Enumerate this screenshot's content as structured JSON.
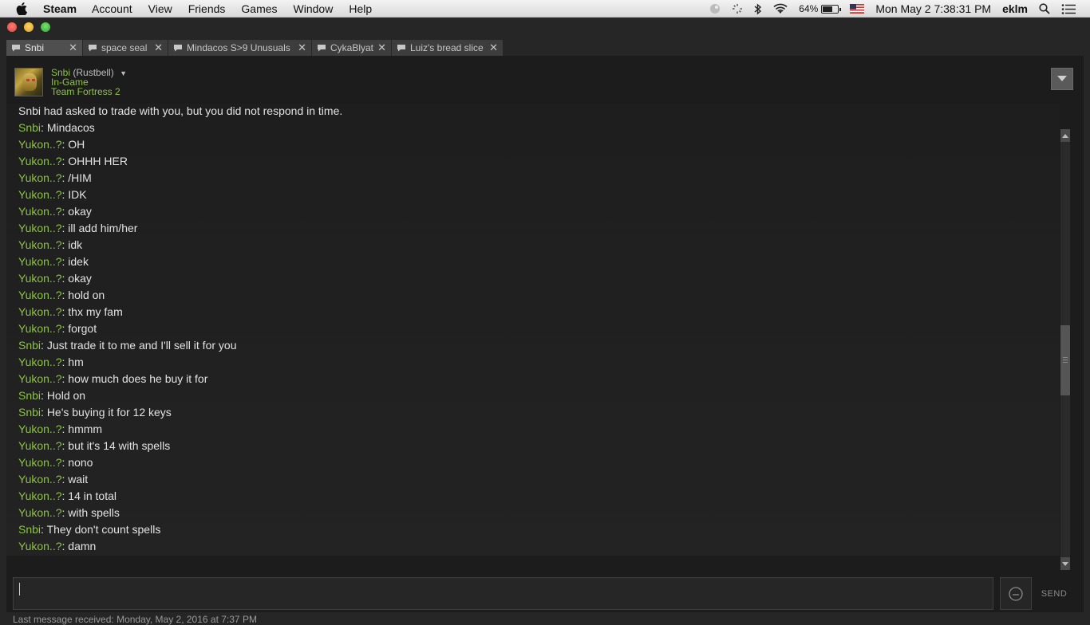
{
  "menubar": {
    "app": "Steam",
    "items": [
      "Account",
      "View",
      "Friends",
      "Games",
      "Window",
      "Help"
    ],
    "battery": "64%",
    "datetime": "Mon May 2  7:38:31 PM",
    "user": "eklm"
  },
  "tabs": [
    {
      "label": "Snbi",
      "active": true
    },
    {
      "label": "space seal",
      "active": false
    },
    {
      "label": "Mindacos S>9 Unusuals",
      "active": false
    },
    {
      "label": "CykaBlyat",
      "active": false
    },
    {
      "label": "Luiz's bread slice",
      "active": false
    }
  ],
  "friend": {
    "name": "Snbi",
    "realname": "(Rustbell)",
    "status": "In-Game",
    "game": "Team Fortress 2"
  },
  "messages": [
    {
      "who": "",
      "text": "Snbi had asked to trade with you, but you did not respond in time.",
      "system": true
    },
    {
      "who": "Snbi",
      "text": "Mindacos"
    },
    {
      "who": "Yukon..?",
      "text": "OH"
    },
    {
      "who": "Yukon..?",
      "text": "OHHH HER"
    },
    {
      "who": "Yukon..?",
      "text": "/HIM"
    },
    {
      "who": "Yukon..?",
      "text": "IDK"
    },
    {
      "who": "Yukon..?",
      "text": "okay"
    },
    {
      "who": "Yukon..?",
      "text": "ill add him/her"
    },
    {
      "who": "Yukon..?",
      "text": "idk"
    },
    {
      "who": "Yukon..?",
      "text": "idek"
    },
    {
      "who": "Yukon..?",
      "text": "okay"
    },
    {
      "who": "Yukon..?",
      "text": "hold on"
    },
    {
      "who": "Yukon..?",
      "text": "thx my fam"
    },
    {
      "who": "Yukon..?",
      "text": "forgot"
    },
    {
      "who": "Snbi",
      "text": "Just trade it to me and I'll sell it for you"
    },
    {
      "who": "Yukon..?",
      "text": "hm"
    },
    {
      "who": "Yukon..?",
      "text": "how much does he buy it for"
    },
    {
      "who": "Snbi",
      "text": "Hold on"
    },
    {
      "who": "Snbi",
      "text": "He's buying it for 12 keys"
    },
    {
      "who": "Yukon..?",
      "text": "hmmm"
    },
    {
      "who": "Yukon..?",
      "text": "but it's 14 with spells"
    },
    {
      "who": "Yukon..?",
      "text": "nono"
    },
    {
      "who": "Yukon..?",
      "text": "wait"
    },
    {
      "who": "Yukon..?",
      "text": "14 in total"
    },
    {
      "who": "Yukon..?",
      "text": "with spells"
    },
    {
      "who": "Snbi",
      "text": "They don't count spells"
    },
    {
      "who": "Yukon..?",
      "text": "damn"
    }
  ],
  "composer": {
    "send_label": "SEND",
    "last_message": "Last message received: Monday, May 2, 2016 at 7:37 PM"
  },
  "colors": {
    "name_green": "#8bc53f",
    "background": "#1c1c1c"
  }
}
